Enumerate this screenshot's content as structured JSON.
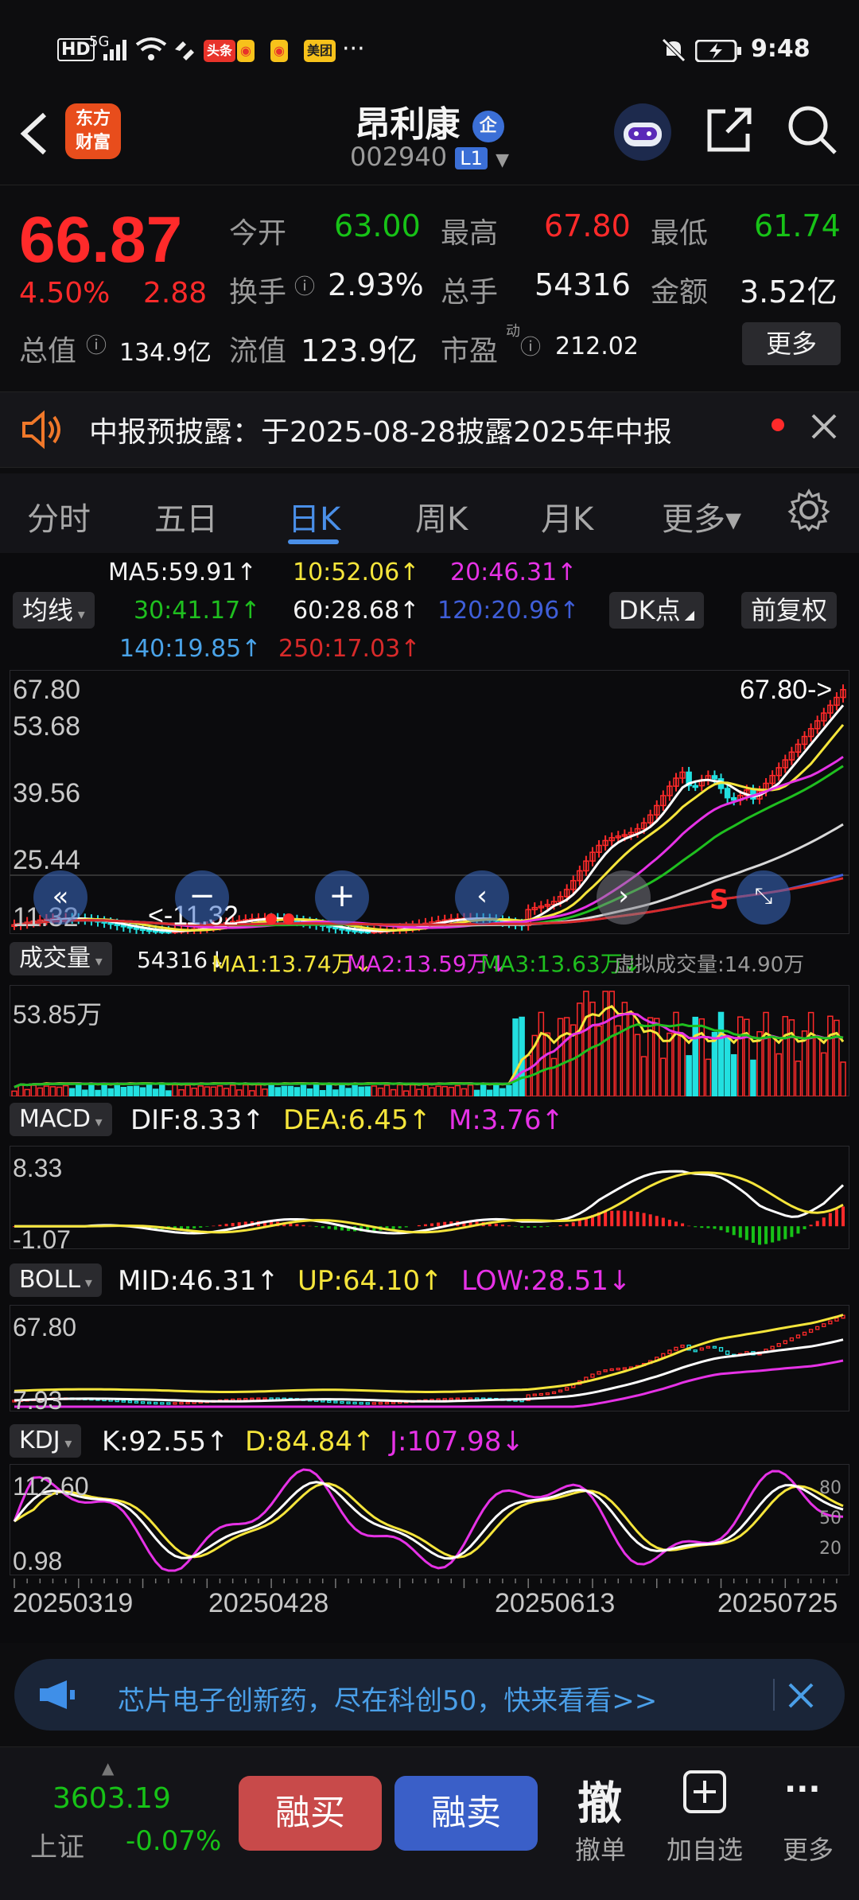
{
  "status_bar": {
    "left_icons": [
      "HD",
      "5G",
      "signal-icon",
      "wifi-icon",
      "nfc-icon"
    ],
    "app_badges": [
      {
        "label": "头条",
        "color": "#e8332a"
      },
      {
        "label": "◉",
        "color": "#e8332a"
      },
      {
        "label": "◉",
        "color": "#e8332a"
      },
      {
        "label": "美团",
        "color": "#f7c21b"
      }
    ],
    "more": "···",
    "time": "9:48"
  },
  "header": {
    "logo_line1": "东方",
    "logo_line2": "财富",
    "stock_name": "昂利康",
    "name_badge": "企",
    "code": "002940",
    "level": "L1"
  },
  "quote": {
    "price": "66.87",
    "change_pct": "4.50%",
    "change": "2.88",
    "open_label": "今开",
    "open": "63.00",
    "high_label": "最高",
    "high": "67.80",
    "low_label": "最低",
    "low": "61.74",
    "turnover_label": "换手",
    "turnover": "2.93%",
    "volume_label": "总手",
    "volume": "54316",
    "amount_label": "金额",
    "amount": "3.52亿",
    "mktcap_label": "总值",
    "mktcap": "134.9亿",
    "float_label": "流值",
    "float": "123.9亿",
    "pe_label": "市盈",
    "pe_sup": "动",
    "pe": "212.02",
    "more_button": "更多"
  },
  "announcement": {
    "text": "中报预披露：于2025-08-28披露2025年中报"
  },
  "tabs": [
    "分时",
    "五日",
    "日K",
    "周K",
    "月K",
    "更多▾"
  ],
  "active_tab": 2,
  "ma_panel": {
    "selector": "均线",
    "ma5": "MA5:59.91↑",
    "ma10": "10:52.06↑",
    "ma20": "20:46.31↑",
    "ma30": "30:41.17↑",
    "ma60": "60:28.68↑",
    "ma120": "120:20.96↑",
    "ma140": "140:19.85↑",
    "ma250": "250:17.03↑",
    "dk_button": "DK点",
    "adjust_button": "前复权",
    "axis": [
      "67.80",
      "53.68",
      "39.56",
      "25.44",
      "11.32"
    ],
    "high_marker": "67.80->",
    "low_marker": "<-11.32"
  },
  "volume_panel": {
    "selector": "成交量",
    "vol": "54316↓",
    "ma1": "MA1:13.74万↓",
    "ma2": "MA2:13.59万↓",
    "ma3": "MA3:13.63万↓",
    "virtual": "虚拟成交量:14.90万",
    "axis_top": "53.85万"
  },
  "macd_panel": {
    "selector": "MACD",
    "dif": "DIF:8.33↑",
    "dea": "DEA:6.45↑",
    "m": "M:3.76↑",
    "axis_top": "8.33",
    "axis_bottom": "-1.07"
  },
  "boll_panel": {
    "selector": "BOLL",
    "mid": "MID:46.31↑",
    "up": "UP:64.10↑",
    "low": "LOW:28.51↓",
    "axis_top": "67.80",
    "axis_bottom": "7.93"
  },
  "kdj_panel": {
    "selector": "KDJ",
    "k": "K:92.55↑",
    "d": "D:84.84↑",
    "j": "J:107.98↓",
    "axis_top": "112.60",
    "axis_bottom": "0.98",
    "right_ticks": [
      "80",
      "50",
      "20"
    ]
  },
  "dates": [
    "20250319",
    "20250428",
    "20250613",
    "20250725"
  ],
  "banner": {
    "text": "芯片电子创新药，尽在科创50，快来看看>>"
  },
  "bottom_bar": {
    "index_value": "3603.19",
    "index_name": "上证",
    "index_change": "-0.07%",
    "buy_button": "融买",
    "sell_button": "融卖",
    "cancel_glyph": "撤",
    "cancel_label": "撤单",
    "add_label": "加自选",
    "more_label": "更多"
  },
  "colors": {
    "up": "#ff2a2a",
    "down": "#17c217",
    "accent": "#4a8fe8",
    "ma5": "#ffffff",
    "ma10": "#f5e53b",
    "ma20": "#e632e6",
    "ma30": "#1fbf1f",
    "ma60": "#d8d8d8",
    "ma120": "#3f5ed8",
    "ma140": "#4aa3e8",
    "ma250": "#d82a2a"
  }
}
